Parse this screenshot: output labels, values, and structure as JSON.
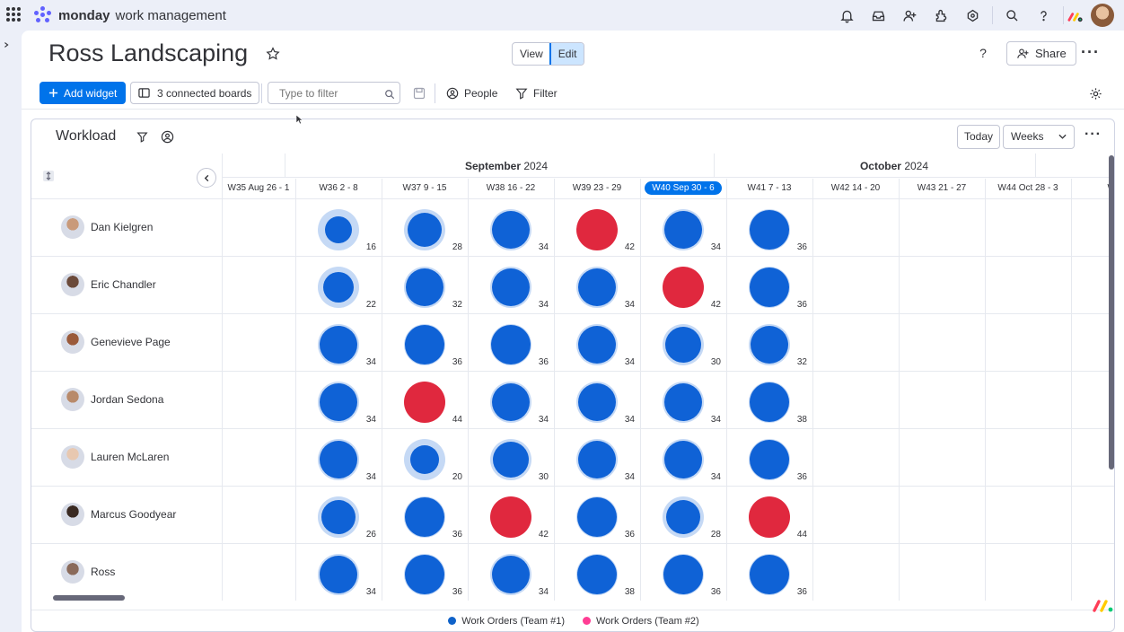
{
  "topbar": {
    "brand_bold": "monday",
    "brand_light": "work management",
    "icons": [
      "bell-icon",
      "inbox-icon",
      "invite-icon",
      "apps-icon",
      "integrations-icon",
      "search-icon",
      "help-icon"
    ]
  },
  "board": {
    "title": "Ross Landscaping",
    "view_label": "View",
    "edit_label": "Edit",
    "help_label": "?",
    "share_label": "Share"
  },
  "toolbar": {
    "add_widget_label": "Add widget",
    "connected_label": "3 connected boards",
    "filter_placeholder": "Type to filter",
    "people_label": "People",
    "filter_label": "Filter"
  },
  "widget": {
    "title": "Workload",
    "today_label": "Today",
    "weeks_label": "Weeks",
    "months": [
      {
        "name": "September",
        "year": "2024"
      },
      {
        "name": "October",
        "year": "2024"
      }
    ],
    "weeks": [
      "W35 Aug 26 - 1",
      "W36 2 - 8",
      "W37 9 - 15",
      "W38 16 - 22",
      "W39 23 - 29",
      "W40 Sep 30 - 6",
      "W41 7 - 13",
      "W42 14 - 20",
      "W43 21 - 27",
      "W44 Oct 28 - 3",
      "W4"
    ],
    "current_week_index": 5,
    "people": [
      {
        "name": "Dan Kielgren",
        "values": [
          16,
          28,
          34,
          42,
          34,
          36
        ]
      },
      {
        "name": "Eric Chandler",
        "values": [
          22,
          32,
          34,
          34,
          42,
          36
        ]
      },
      {
        "name": "Genevieve Page",
        "values": [
          34,
          36,
          36,
          34,
          30,
          32
        ]
      },
      {
        "name": "Jordan Sedona",
        "values": [
          34,
          44,
          34,
          34,
          34,
          38
        ]
      },
      {
        "name": "Lauren McLaren",
        "values": [
          34,
          20,
          30,
          34,
          34,
          36
        ]
      },
      {
        "name": "Marcus Goodyear",
        "values": [
          26,
          36,
          42,
          36,
          28,
          44
        ]
      },
      {
        "name": "Ross",
        "values": [
          34,
          36,
          34,
          38,
          36,
          36
        ]
      }
    ],
    "capacity": 40,
    "legend": [
      {
        "label": "Work Orders (Team #1)",
        "color": "#0f62c9"
      },
      {
        "label": "Work Orders (Team #2)",
        "color": "#ff3d94"
      }
    ],
    "colors": {
      "normal": "#0f62d6",
      "over": "#e0283e",
      "ring": "#c5d9f5"
    }
  }
}
